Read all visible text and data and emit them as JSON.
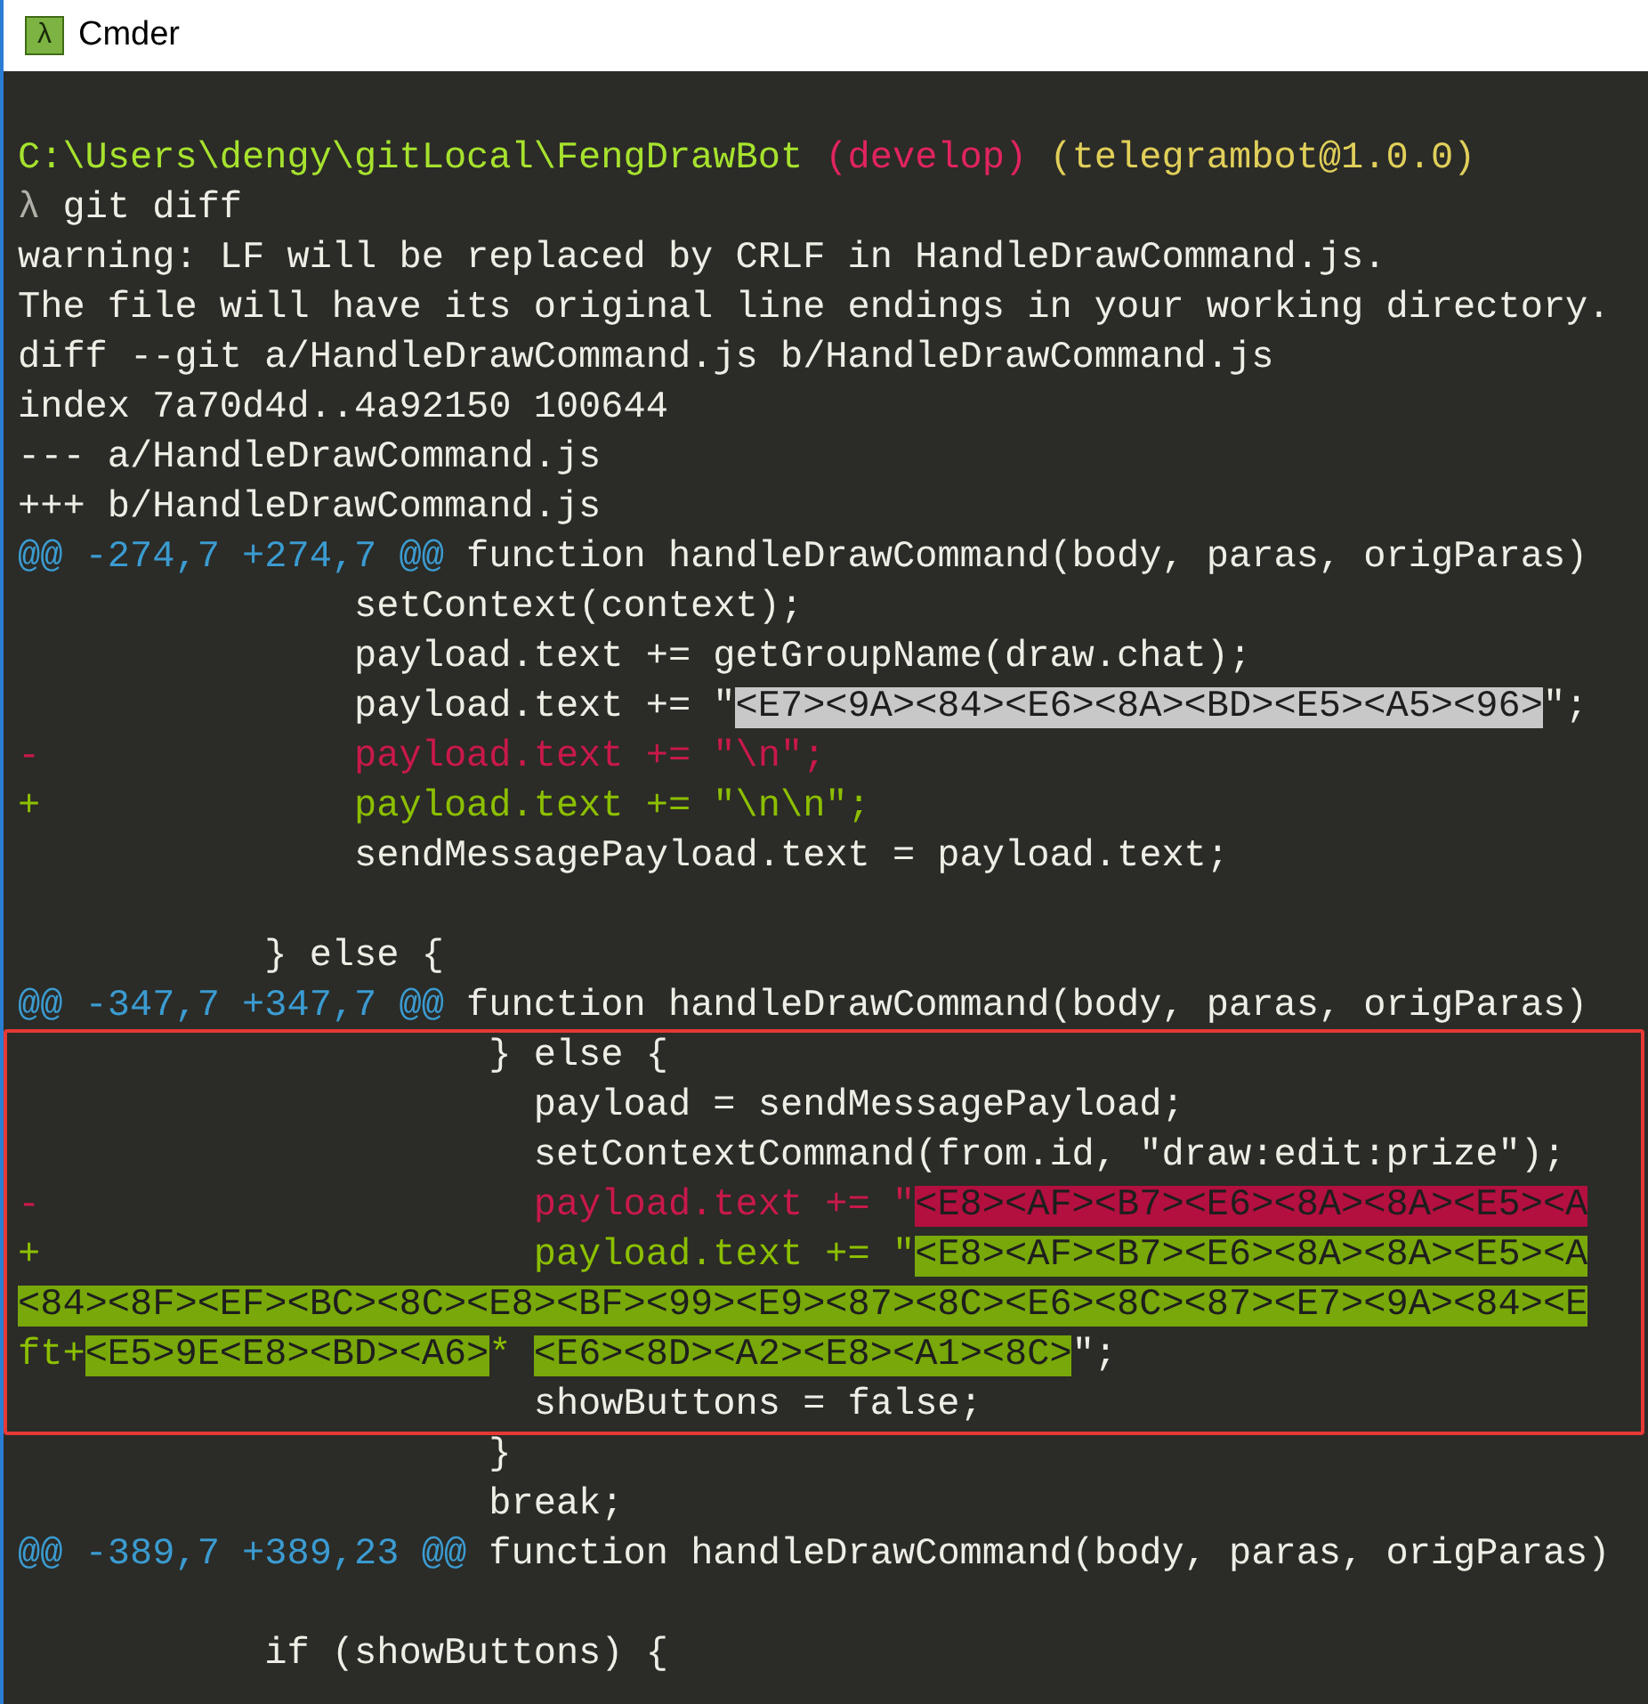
{
  "window": {
    "title": "Cmder",
    "icon_glyph": "λ"
  },
  "terminal": {
    "lines": [
      {
        "framed": false,
        "segments": [
          {
            "text": "C:\\Users\\dengy\\gitLocal\\FengDrawBot",
            "kind": "path"
          },
          {
            "text": " (develop)",
            "kind": "branch"
          },
          {
            "text": " (telegrambot@1.0.0)",
            "kind": "package"
          }
        ]
      },
      {
        "framed": false,
        "segments": [
          {
            "text": "λ",
            "kind": "symbol"
          },
          {
            "text": " git diff",
            "kind": "plain"
          }
        ]
      },
      {
        "framed": false,
        "segments": [
          {
            "text": "warning: LF will be replaced by CRLF in HandleDrawCommand.js.",
            "kind": "plain"
          }
        ]
      },
      {
        "framed": false,
        "segments": [
          {
            "text": "The file will have its original line endings in your working directory.",
            "kind": "plain"
          }
        ]
      },
      {
        "framed": false,
        "segments": [
          {
            "text": "diff --git a/HandleDrawCommand.js b/HandleDrawCommand.js",
            "kind": "plain"
          }
        ]
      },
      {
        "framed": false,
        "segments": [
          {
            "text": "index 7a70d4d..4a92150 100644",
            "kind": "plain"
          }
        ]
      },
      {
        "framed": false,
        "segments": [
          {
            "text": "--- a/HandleDrawCommand.js",
            "kind": "plain"
          }
        ]
      },
      {
        "framed": false,
        "segments": [
          {
            "text": "+++ b/HandleDrawCommand.js",
            "kind": "plain"
          }
        ]
      },
      {
        "framed": false,
        "segments": [
          {
            "text": "@@ -274,7 +274,7 @@",
            "kind": "hunk"
          },
          {
            "text": " function handleDrawCommand(body, paras, origParas)",
            "kind": "plain"
          }
        ]
      },
      {
        "framed": false,
        "segments": [
          {
            "text": "               setContext(context);",
            "kind": "plain"
          }
        ]
      },
      {
        "framed": false,
        "segments": [
          {
            "text": "               payload.text += getGroupName(draw.chat);",
            "kind": "plain"
          }
        ]
      },
      {
        "framed": false,
        "segments": [
          {
            "text": "               payload.text += \"",
            "kind": "plain"
          },
          {
            "text": "<E7><9A><84><E6><8A><BD><E5><A5><96>",
            "kind": "mark"
          },
          {
            "text": "\";",
            "kind": "plain"
          }
        ]
      },
      {
        "framed": false,
        "segments": [
          {
            "text": "-              payload.text += \"\\n\";",
            "kind": "removed"
          }
        ]
      },
      {
        "framed": false,
        "segments": [
          {
            "text": "+              payload.text += \"\\n\\n\";",
            "kind": "added"
          }
        ]
      },
      {
        "framed": false,
        "segments": [
          {
            "text": "               sendMessagePayload.text = payload.text;",
            "kind": "plain"
          }
        ]
      },
      {
        "framed": false
      },
      {
        "framed": false,
        "segments": [
          {
            "text": "           } else {",
            "kind": "plain"
          }
        ]
      },
      {
        "framed": false,
        "segments": [
          {
            "text": "@@ -347,7 +347,7 @@",
            "kind": "hunk"
          },
          {
            "text": " function handleDrawCommand(body, paras, origParas)",
            "kind": "plain"
          }
        ]
      },
      {
        "framed": true,
        "segments": [
          {
            "text": "                     } else {",
            "kind": "plain"
          }
        ]
      },
      {
        "framed": true,
        "segments": [
          {
            "text": "                       payload = sendMessagePayload;",
            "kind": "plain"
          }
        ]
      },
      {
        "framed": true,
        "segments": [
          {
            "text": "                       setContextCommand(from.id, \"draw:edit:prize\");",
            "kind": "plain"
          }
        ]
      },
      {
        "framed": true,
        "segments": [
          {
            "text": "-                      payload.text += \"",
            "kind": "removed"
          },
          {
            "text": "<E8><AF><B7><E6><8A><8A><E5><A",
            "kind": "removed_mark"
          }
        ]
      },
      {
        "framed": true,
        "segments": [
          {
            "text": "+                      payload.text += \"",
            "kind": "added"
          },
          {
            "text": "<E8><AF><B7><E6><8A><8A><E5><A",
            "kind": "added_mark"
          }
        ]
      },
      {
        "framed": true,
        "segments": [
          {
            "text": "<84><8F><EF><BC><8C><E8><BF><99><E9><87><8C><E6><8C><87><E7><9A><84><E",
            "kind": "added_mark"
          }
        ]
      },
      {
        "framed": true,
        "segments": [
          {
            "text": "ft+",
            "kind": "added"
          },
          {
            "text": "<E5>9E<E8><BD><A6>",
            "kind": "added_mark"
          },
          {
            "text": "* ",
            "kind": "added"
          },
          {
            "text": "<E6><8D><A2><E8><A1><8C>",
            "kind": "added_mark"
          },
          {
            "text": "\";",
            "kind": "plain"
          }
        ]
      },
      {
        "framed": true,
        "segments": [
          {
            "text": "                       showButtons = false;",
            "kind": "plain"
          }
        ]
      },
      {
        "framed": false,
        "segments": [
          {
            "text": "                     }",
            "kind": "plain"
          }
        ]
      },
      {
        "framed": false,
        "segments": [
          {
            "text": "                     break;",
            "kind": "plain"
          }
        ]
      },
      {
        "framed": false,
        "segments": [
          {
            "text": "@@ -389,7 +389,23 @@",
            "kind": "hunk"
          },
          {
            "text": " function handleDrawCommand(body, paras, origParas)",
            "kind": "plain"
          }
        ]
      },
      {
        "framed": false
      },
      {
        "framed": false,
        "segments": [
          {
            "text": "           if (showButtons) {",
            "kind": "plain"
          }
        ]
      }
    ]
  }
}
